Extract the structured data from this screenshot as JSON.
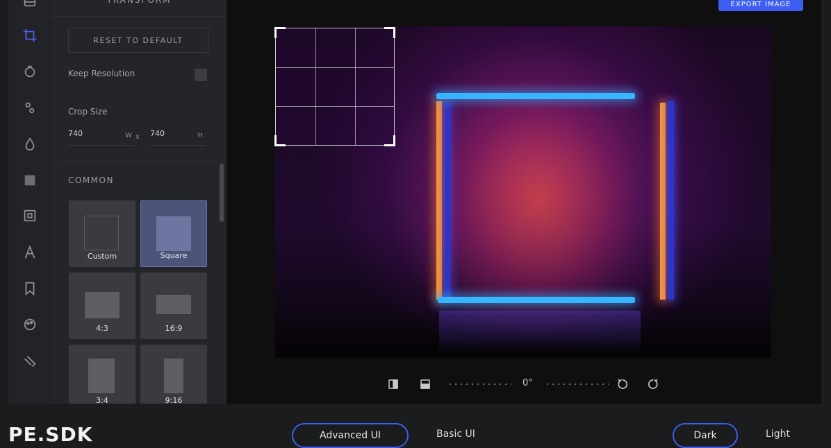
{
  "panel": {
    "title": "TRANSFORM",
    "reset_label": "RESET TO DEFAULT",
    "keep_resolution_label": "Keep Resolution",
    "crop_size_label": "Crop Size",
    "width_value": "740",
    "width_unit": "W",
    "times": "x",
    "height_value": "740",
    "height_unit": "H",
    "common_label": "COMMON",
    "presets": [
      {
        "label": "Custom"
      },
      {
        "label": "Square"
      },
      {
        "label": "4:3"
      },
      {
        "label": "16:9"
      },
      {
        "label": "3:4"
      },
      {
        "label": "9:16"
      }
    ]
  },
  "rail": {
    "icons": [
      "library-icon",
      "crop-icon",
      "filter-icon",
      "adjust-icon",
      "focus-icon",
      "overlay-icon",
      "frame-icon",
      "text-icon",
      "sticker-icon",
      "brush-icon",
      "color-icon"
    ]
  },
  "canvas": {
    "export_label": "EXPORT IMAGE",
    "angle": "0°"
  },
  "footer": {
    "brand": "PE.SDK",
    "advanced_ui": "Advanced UI",
    "basic_ui": "Basic UI",
    "dark": "Dark",
    "light": "Light"
  },
  "colors": {
    "accent": "#3d5ef0",
    "selected_preset": "#4d5479"
  }
}
